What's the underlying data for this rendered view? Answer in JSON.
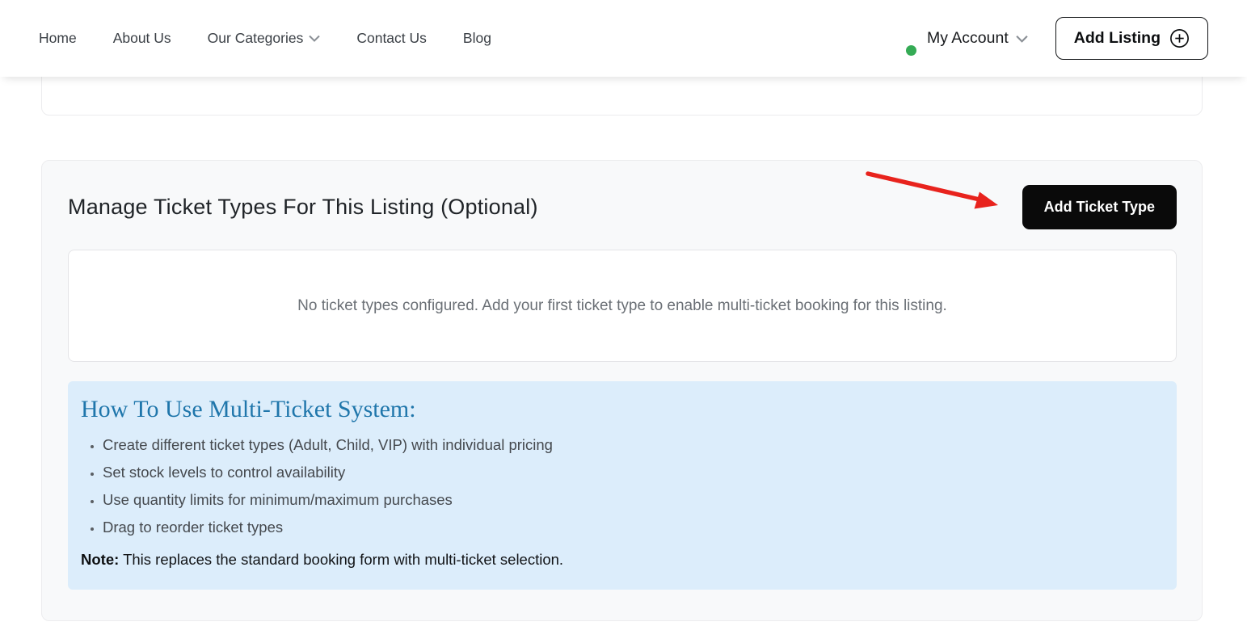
{
  "nav": {
    "items": [
      "Home",
      "About Us",
      "Our Categories",
      "Contact Us",
      "Blog"
    ]
  },
  "account": {
    "label": "My Account"
  },
  "add_listing": {
    "label": "Add Listing"
  },
  "manage": {
    "title": "Manage Ticket Types For This Listing (Optional)",
    "add_button": "Add Ticket Type",
    "empty_message": "No ticket types configured. Add your first ticket type to enable multi-ticket booking for this listing.",
    "info": {
      "heading": "How To Use Multi-Ticket System:",
      "tips": [
        "Create different ticket types (Adult, Child, VIP) with individual pricing",
        "Set stock levels to control availability",
        "Use quantity limits for minimum/maximum purchases",
        "Drag to reorder ticket types"
      ],
      "note_label": "Note:",
      "note_text": "This replaces the standard booking form with multi-ticket selection."
    }
  },
  "colors": {
    "accent_blue": "#1f76ab",
    "info_box_bg": "#dcedfb",
    "button_black": "#0a0a0a",
    "annotation_red": "#e8231d",
    "status_green": "#35ab55"
  }
}
